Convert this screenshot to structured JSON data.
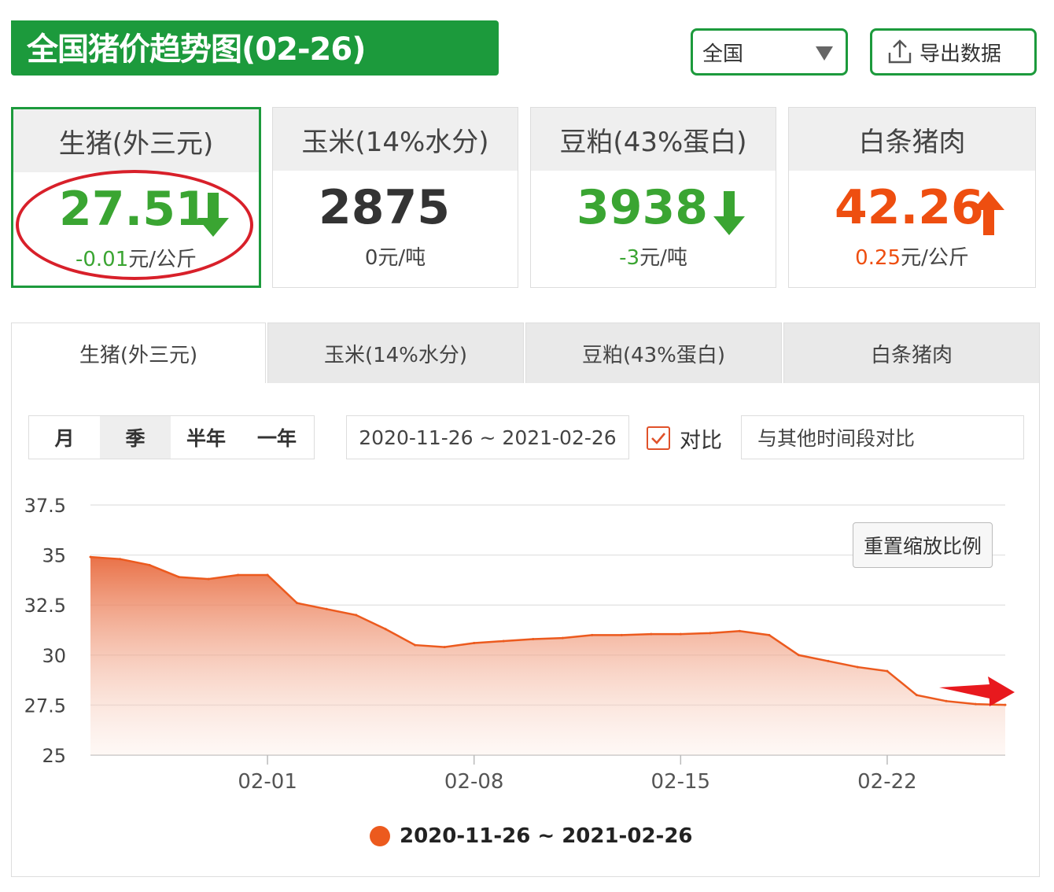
{
  "header": {
    "title": "全国猪价趋势图(02-26)",
    "region_select": "全国",
    "export_label": "导出数据"
  },
  "cards": [
    {
      "name": "生猪(外三元)",
      "value": "27.51",
      "trend": "down",
      "change": "-0.01",
      "unit": "元/公斤"
    },
    {
      "name": "玉米(14%水分)",
      "value": "2875",
      "trend": "flat",
      "change": "0",
      "unit": "元/吨"
    },
    {
      "name": "豆粕(43%蛋白)",
      "value": "3938",
      "trend": "down",
      "change": "-3",
      "unit": "元/吨"
    },
    {
      "name": "白条猪肉",
      "value": "42.26",
      "trend": "up",
      "change": "0.25",
      "unit": "元/公斤"
    }
  ],
  "tabs": [
    "生猪(外三元)",
    "玉米(14%水分)",
    "豆粕(43%蛋白)",
    "白条猪肉"
  ],
  "controls": {
    "ranges": [
      "月",
      "季",
      "半年",
      "一年"
    ],
    "selected_range": "季",
    "date_range": "2020-11-26 ~ 2021-02-26",
    "compare_label": "对比",
    "compare_checked": true,
    "compare_placeholder": "与其他时间段对比",
    "reset_label": "重置缩放比例"
  },
  "colors": {
    "brand_green": "#1c9a3c",
    "down_green": "#3aa532",
    "up_red": "#ee4e10",
    "series": "#ec5a1e"
  },
  "chart_data": {
    "type": "area",
    "y_ticks": [
      "37.5",
      "35",
      "32.5",
      "30",
      "27.5",
      "25"
    ],
    "ylim": [
      25,
      37.5
    ],
    "x_tick_labels": [
      "02-01",
      "02-08",
      "02-15",
      "02-22"
    ],
    "x_tick_days": [
      6,
      13,
      20,
      27
    ],
    "legend": "2020-11-26 ~ 2021-02-26",
    "series": [
      {
        "day": [
          0,
          1,
          2,
          3,
          4,
          5,
          6,
          7,
          8,
          9,
          10,
          11,
          12,
          13,
          14,
          15,
          16,
          17,
          18,
          19,
          20,
          21,
          22,
          23,
          24,
          25,
          26,
          27,
          28,
          29,
          30,
          31
        ],
        "values": [
          34.9,
          34.8,
          34.5,
          33.9,
          33.8,
          34.0,
          34.0,
          32.6,
          32.3,
          32.0,
          31.3,
          30.5,
          30.4,
          30.6,
          30.7,
          30.8,
          30.85,
          31.0,
          31.0,
          31.05,
          31.05,
          31.1,
          31.2,
          31.0,
          30.0,
          29.7,
          29.4,
          29.2,
          28.0,
          27.7,
          27.55,
          27.51
        ]
      }
    ]
  }
}
